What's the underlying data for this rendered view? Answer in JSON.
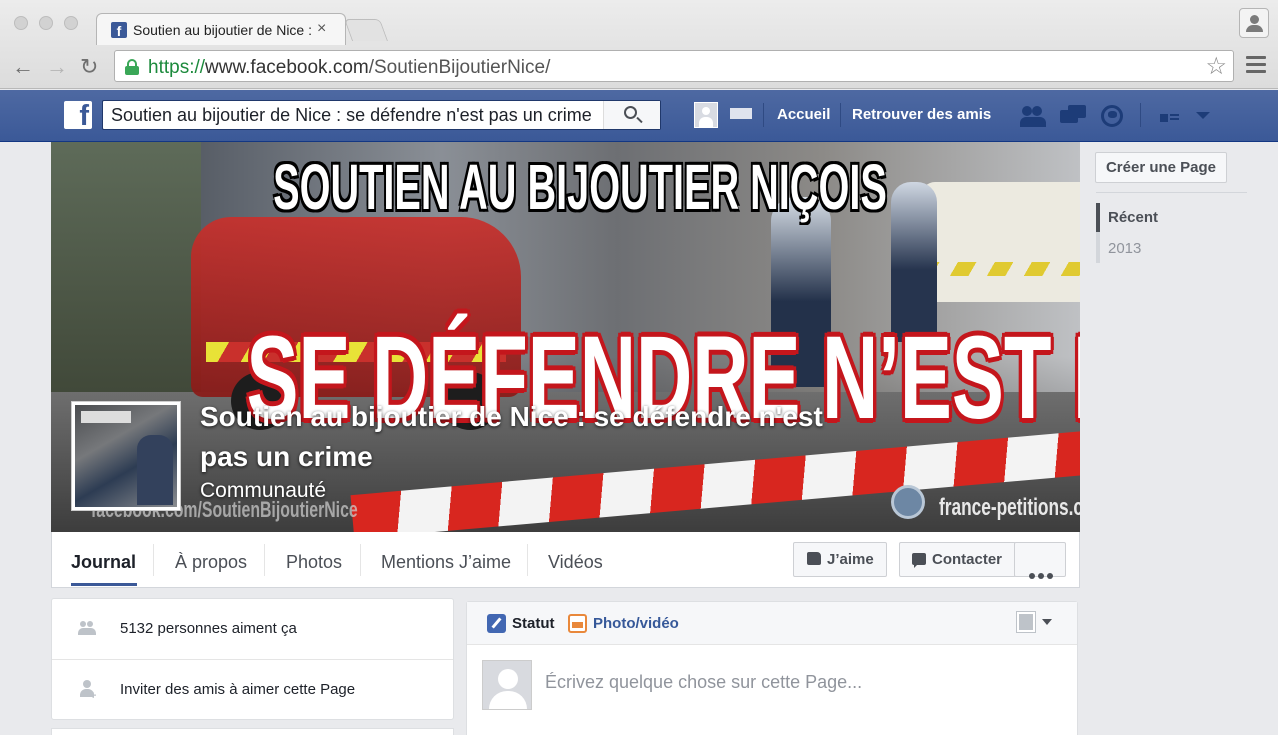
{
  "browser": {
    "tab_title": "Soutien au bijoutier de Nice : se défendre n'est pas un crime",
    "tab_close": "×",
    "url_scheme": "https://",
    "url_host": "www.facebook.com",
    "url_path": "/SoutienBijoutierNice/",
    "back_glyph": "←",
    "forward_glyph": "→",
    "reload_glyph": "↻",
    "star_glyph": "☆"
  },
  "fb_header": {
    "logo": "f",
    "search_value": "Soutien au bijoutier de Nice : se défendre n'est pas un crime",
    "links": [
      "Accueil",
      "Retrouver des amis"
    ]
  },
  "cover": {
    "headline_top": "SOUTIEN AU BIJOUTIER NIÇOIS",
    "headline_main": "SE DÉFENDRE N’EST PAS UN CRIME !",
    "watermark_left": "facebook.com/SoutienBijoutierNice",
    "watermark_right": "france-petitions.com"
  },
  "page": {
    "name": "Soutien au bijoutier de Nice : se défendre n'est pas un crime",
    "category": "Communauté"
  },
  "page_nav": {
    "tabs": [
      "Journal",
      "À propos",
      "Photos",
      "Mentions J’aime",
      "Vidéos"
    ],
    "like_button": "J’aime",
    "contact_button": "Contacter"
  },
  "right_column": {
    "create_page": "Créer une Page",
    "timeline": [
      "Récent",
      "2013"
    ]
  },
  "left_column": {
    "likes_text": "5132 personnes aiment ça",
    "invite_text": "Inviter des amis à aimer cette Page"
  },
  "composer": {
    "status_tab": "Statut",
    "photo_tab": "Photo/vidéo",
    "placeholder": "Écrivez quelque chose sur cette Page..."
  },
  "colors": {
    "facebook_blue": "#3b5998",
    "url_green": "#1c8a3c",
    "page_background": "#e9eaed"
  }
}
